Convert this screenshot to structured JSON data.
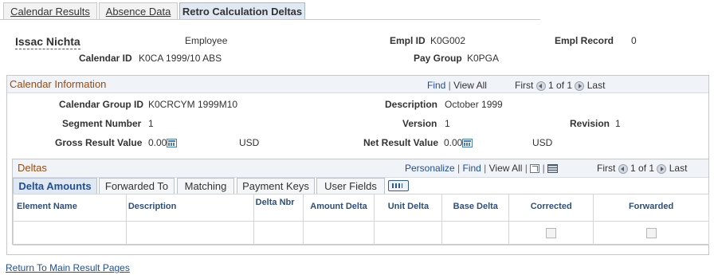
{
  "top_tabs": [
    "Calendar Results",
    "Absence Data",
    "Retro Calculation Deltas"
  ],
  "header": {
    "name": "Issac Nichta",
    "role": "Employee",
    "empl_id_label": "Empl ID",
    "empl_id": "K0G002",
    "empl_record_label": "Empl Record",
    "empl_record": "0",
    "calendar_id_label": "Calendar ID",
    "calendar_id": "K0CA 1999/10 ABS",
    "pay_group_label": "Pay Group",
    "pay_group": "K0PGA"
  },
  "calendar_info": {
    "title": "Calendar Information",
    "find": "Find",
    "view_all": "View All",
    "first": "First",
    "counter": "1 of 1",
    "last": "Last",
    "group_id_label": "Calendar Group ID",
    "group_id": "K0CRCYM 1999M10",
    "description_label": "Description",
    "description": "October 1999",
    "segment_label": "Segment Number",
    "segment": "1",
    "version_label": "Version",
    "version": "1",
    "revision_label": "Revision",
    "revision": "1",
    "gross_label": "Gross Result Value",
    "gross": "0.00",
    "gross_currency": "USD",
    "net_label": "Net Result Value",
    "net": "0.00",
    "net_currency": "USD"
  },
  "deltas": {
    "title": "Deltas",
    "personalize": "Personalize",
    "find": "Find",
    "view_all": "View All",
    "first": "First",
    "counter": "1 of 1",
    "last": "Last",
    "tabs": [
      "Delta Amounts",
      "Forwarded To",
      "Matching",
      "Payment Keys",
      "User Fields"
    ],
    "columns": [
      "Element Name",
      "Description",
      "Delta Nbr",
      "Amount Delta",
      "Unit Delta",
      "Base Delta",
      "Corrected",
      "Forwarded"
    ]
  },
  "return_link": "Return To Main Result Pages"
}
